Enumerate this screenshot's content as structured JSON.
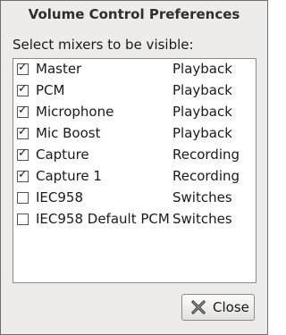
{
  "window": {
    "title": "Volume Control Preferences"
  },
  "prompt": "Select mixers to be visible:",
  "mixers": [
    {
      "name": "Master",
      "type": "Playback",
      "checked": true
    },
    {
      "name": "PCM",
      "type": "Playback",
      "checked": true
    },
    {
      "name": "Microphone",
      "type": "Playback",
      "checked": true
    },
    {
      "name": "Mic Boost",
      "type": "Playback",
      "checked": true
    },
    {
      "name": "Capture",
      "type": "Recording",
      "checked": true
    },
    {
      "name": "Capture 1",
      "type": "Recording",
      "checked": true
    },
    {
      "name": "IEC958",
      "type": "Switches",
      "checked": false
    },
    {
      "name": "IEC958 Default PCM",
      "type": "Switches",
      "checked": false
    }
  ],
  "buttons": {
    "close_label": "Close",
    "close_icon": "close-icon"
  }
}
